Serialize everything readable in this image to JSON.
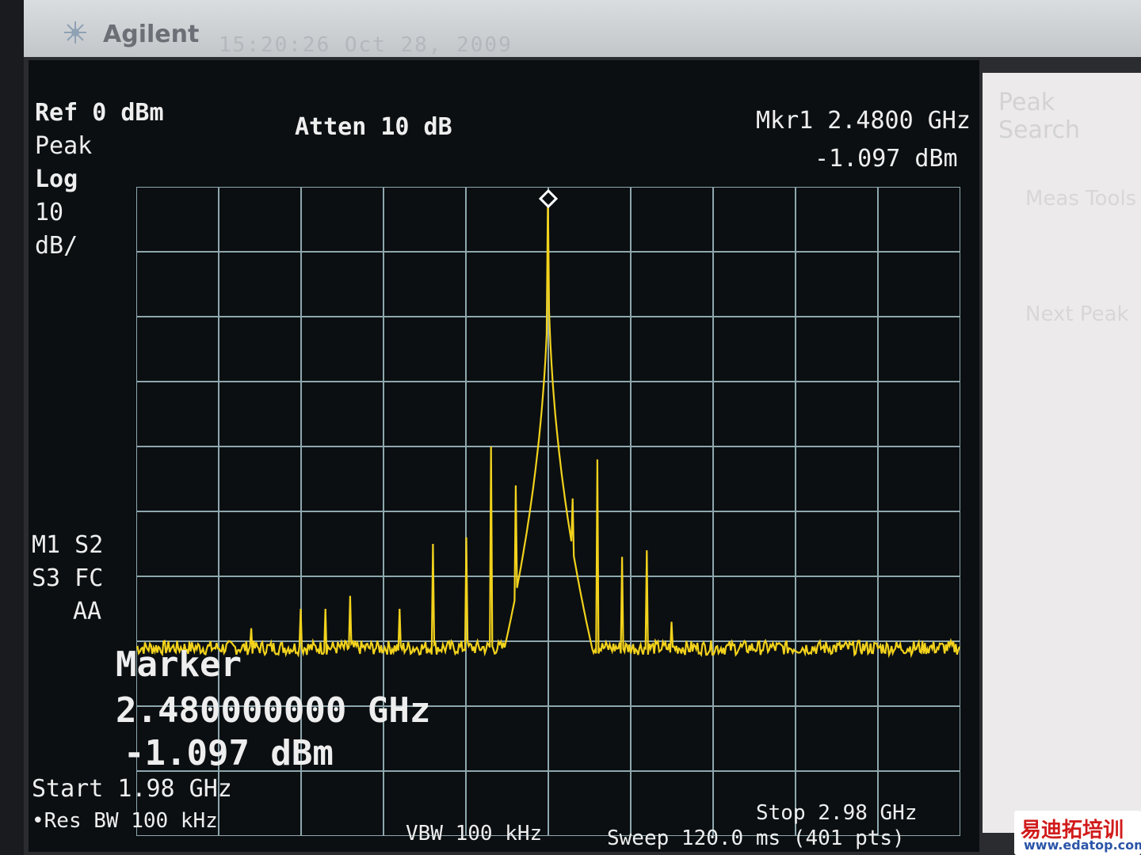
{
  "window": {
    "brand": "Agilent",
    "datetime": "15:20:26  Oct 28, 2009"
  },
  "header": {
    "ref": "Ref 0 dBm",
    "detector": "Peak",
    "scale_type": "Log",
    "scale_value": "10",
    "scale_unit": "dB/",
    "atten": "Atten 10 dB",
    "marker_label": "Mkr1  2.4800 GHz",
    "marker_amplitude": "-1.097 dBm"
  },
  "side_flags": {
    "line1": "M1 S2",
    "line2": "S3 FC",
    "line3": "AA"
  },
  "marker_readout": {
    "title": "Marker",
    "frequency": "2.480000000 GHz",
    "amplitude": "-1.097 dBm"
  },
  "footer": {
    "start": "Start 1.98 GHz",
    "res_bw": "•Res BW 100 kHz",
    "vbw": "VBW 100 kHz",
    "stop": "Stop 2.98 GHz",
    "sweep": "Sweep 120.0 ms (401 pts)"
  },
  "softkeys": {
    "title": "Peak Search",
    "items": [
      "Meas Tools",
      "Next Peak"
    ]
  },
  "watermark": {
    "text": "易迪拓培训",
    "url": "www.edatop.com"
  },
  "colors": {
    "trace": "#f2d21c",
    "grid": "#8ea7ad",
    "screen_bg": "#0b0f12",
    "text": "#eeeeee"
  },
  "chart_data": {
    "type": "line",
    "xlabel": "",
    "ylabel": "",
    "xlim": [
      1.98,
      2.98
    ],
    "ylim": [
      -100,
      0
    ],
    "x_unit": "GHz",
    "y_unit": "dBm",
    "grid": true,
    "noise_floor": -71,
    "series": [
      {
        "peaks": [
          {
            "x": 2.12,
            "y": -68
          },
          {
            "x": 2.18,
            "y": -65
          },
          {
            "x": 2.21,
            "y": -65
          },
          {
            "x": 2.24,
            "y": -63
          },
          {
            "x": 2.3,
            "y": -65
          },
          {
            "x": 2.34,
            "y": -55
          },
          {
            "x": 2.38,
            "y": -54
          },
          {
            "x": 2.41,
            "y": -40
          },
          {
            "x": 2.44,
            "y": -46
          },
          {
            "x": 2.48,
            "y": -1.097
          },
          {
            "x": 2.51,
            "y": -48
          },
          {
            "x": 2.54,
            "y": -42
          },
          {
            "x": 2.57,
            "y": -57
          },
          {
            "x": 2.6,
            "y": -56
          },
          {
            "x": 2.63,
            "y": -67
          }
        ]
      }
    ],
    "markers": [
      {
        "name": "M1",
        "x": 2.48,
        "y": -1.097
      }
    ]
  }
}
